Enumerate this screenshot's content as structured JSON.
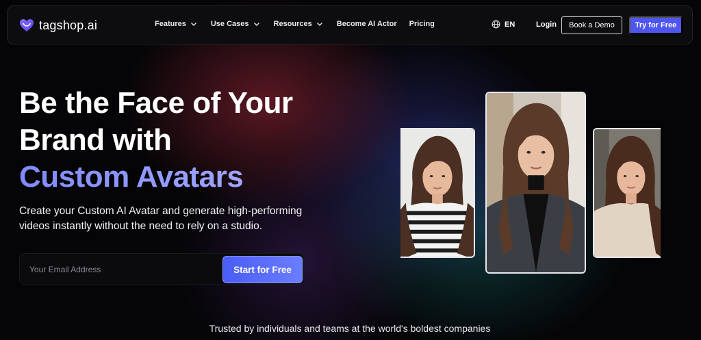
{
  "brand": {
    "name": "tagshop.ai"
  },
  "nav": {
    "menu": [
      {
        "label": "Features",
        "has_dropdown": true
      },
      {
        "label": "Use Cases",
        "has_dropdown": true
      },
      {
        "label": "Resources",
        "has_dropdown": true
      },
      {
        "label": "Become AI Actor",
        "has_dropdown": false
      },
      {
        "label": "Pricing",
        "has_dropdown": false
      }
    ],
    "language": "EN",
    "login": "Login",
    "book_demo": "Book a Demo",
    "try_free": "Try for Free"
  },
  "hero": {
    "headline_line1": "Be the Face of Your",
    "headline_line2": "Brand with",
    "headline_highlight": "Custom Avatars",
    "subtitle": "Create your Custom AI Avatar and generate high-performing videos instantly without the need to rely on a studio.",
    "email_placeholder": "Your Email Address",
    "cta": "Start for Free"
  },
  "trusted_text": "Trusted by individuals and teams at the world's boldest companies",
  "colors": {
    "accent": "#4f56f0",
    "headline_gradient_start": "#7f8cff",
    "headline_gradient_end": "#b7b4ff"
  }
}
